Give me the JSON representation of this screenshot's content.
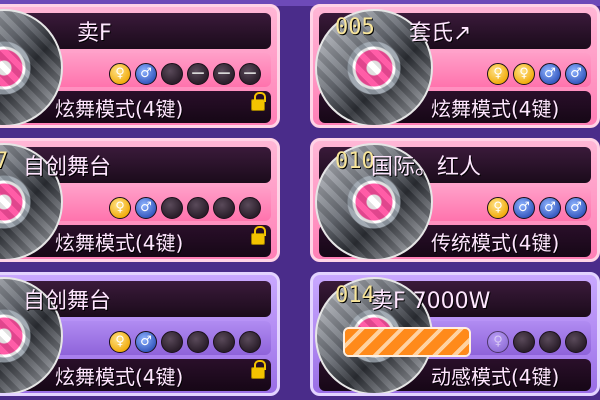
{
  "rooms": [
    {
      "id": "room-left-top",
      "number": "",
      "name": "卖F",
      "mode": "炫舞模式(4键)",
      "locked": true,
      "slots": [
        {
          "type": "female",
          "glyph": "♀"
        },
        {
          "type": "male",
          "glyph": "♂"
        },
        {
          "type": "empty",
          "glyph": ""
        },
        {
          "type": "empty-dash",
          "glyph": "—"
        },
        {
          "type": "empty-dash",
          "glyph": "—"
        },
        {
          "type": "empty-dash",
          "glyph": "—"
        }
      ]
    },
    {
      "id": "room-right-top",
      "number": "005",
      "name": "套氏↗",
      "mode": "炫舞模式(4键)",
      "locked": false,
      "slots": [
        {
          "type": "female",
          "glyph": "♀"
        },
        {
          "type": "female",
          "glyph": "♀"
        },
        {
          "type": "male",
          "glyph": "♂"
        },
        {
          "type": "male",
          "glyph": "♂"
        }
      ]
    },
    {
      "id": "room-left-mid",
      "number": "7",
      "name": "自创舞台",
      "mode": "炫舞模式(4键)",
      "locked": true,
      "slots": [
        {
          "type": "female",
          "glyph": "♀"
        },
        {
          "type": "male",
          "glyph": "♂"
        },
        {
          "type": "empty",
          "glyph": ""
        },
        {
          "type": "empty",
          "glyph": ""
        },
        {
          "type": "empty",
          "glyph": ""
        },
        {
          "type": "empty",
          "glyph": ""
        }
      ]
    },
    {
      "id": "room-right-mid",
      "number": "010",
      "name": "国际。红人",
      "mode": "传统模式(4键)",
      "locked": false,
      "slots": [
        {
          "type": "female",
          "glyph": "♀"
        },
        {
          "type": "male",
          "glyph": "♂"
        },
        {
          "type": "male",
          "glyph": "♂"
        },
        {
          "type": "male",
          "glyph": "♂"
        }
      ]
    },
    {
      "id": "room-left-bottom",
      "number": "",
      "name": "自创舞台",
      "mode": "炫舞模式(4键)",
      "locked": true,
      "slots": [
        {
          "type": "female",
          "glyph": "♀"
        },
        {
          "type": "male",
          "glyph": "♂"
        },
        {
          "type": "empty",
          "glyph": ""
        },
        {
          "type": "empty",
          "glyph": ""
        },
        {
          "type": "empty",
          "glyph": ""
        },
        {
          "type": "empty",
          "glyph": ""
        }
      ]
    },
    {
      "id": "room-right-bottom",
      "number": "014",
      "name": "卖F 7000W",
      "mode": "动感模式(4键)",
      "locked": false,
      "progress": 1.0,
      "slots": [
        {
          "type": "faint",
          "glyph": "♀"
        },
        {
          "type": "empty",
          "glyph": ""
        },
        {
          "type": "empty",
          "glyph": ""
        },
        {
          "type": "empty",
          "glyph": ""
        }
      ]
    }
  ],
  "colors": {
    "pink_card": "#ff7fb6",
    "purple_card": "#9a6ee6",
    "number_text": "#f8e59a",
    "progress_stripe": "#ff8a1a",
    "female_slot": "#f0a600",
    "male_slot": "#2c4fb8"
  },
  "icons": {
    "lock": "lock-icon",
    "female": "female-icon",
    "male": "male-icon",
    "disc": "disc-avatar-icon"
  }
}
